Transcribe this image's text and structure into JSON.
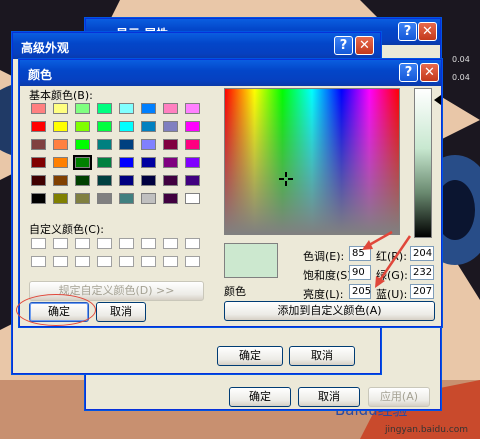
{
  "windows": {
    "display_props": {
      "title": "显示 属性"
    },
    "advanced": {
      "title": "高级外观",
      "ok": "确定",
      "cancel": "取消"
    },
    "color": {
      "title": "颜色"
    },
    "help_btn": "?",
    "close_btn": "✕"
  },
  "color_dialog": {
    "basic_label": "基本颜色(B):",
    "custom_label": "自定义颜色(C):",
    "define_custom_button": "规定自定义颜色(D) >>",
    "ok_button": "确定",
    "cancel_button": "取消",
    "color_solid_label": "颜色",
    "hue_label": "色调(E):",
    "sat_label": "饱和度(S):",
    "lum_label": "亮度(L):",
    "red_label": "红(R):",
    "green_label": "绿(G):",
    "blue_label": "蓝(U):",
    "hue_value": "85",
    "sat_value": "90",
    "lum_value": "205",
    "red_value": "204",
    "green_value": "232",
    "blue_value": "207",
    "add_custom_button": "添加到自定义颜色(A)",
    "preview_color": "#cce8cf",
    "basic_colors": [
      "#ff8080",
      "#ffff80",
      "#80ff80",
      "#00ff80",
      "#80ffff",
      "#0080ff",
      "#ff80c0",
      "#ff80ff",
      "#ff0000",
      "#ffff00",
      "#80ff00",
      "#00ff40",
      "#00ffff",
      "#0080c0",
      "#8080c0",
      "#ff00ff",
      "#804040",
      "#ff8040",
      "#00ff00",
      "#008080",
      "#004080",
      "#8080ff",
      "#800040",
      "#ff0080",
      "#800000",
      "#ff8000",
      "#008000",
      "#008040",
      "#0000ff",
      "#0000a0",
      "#800080",
      "#8000ff",
      "#400000",
      "#804000",
      "#004000",
      "#004040",
      "#000080",
      "#000040",
      "#400040",
      "#400080",
      "#000000",
      "#808000",
      "#808040",
      "#808080",
      "#408080",
      "#c0c0c0",
      "#400040",
      "#ffffff"
    ],
    "selected_index": 26
  },
  "behind": {
    "ok": "确定",
    "cancel": "取消",
    "apply": "应用(A)"
  },
  "watermark": {
    "text1": "Baidu经验",
    "text2": "jingyan.baidu.com"
  },
  "right_side": {
    "text": "0.04"
  }
}
